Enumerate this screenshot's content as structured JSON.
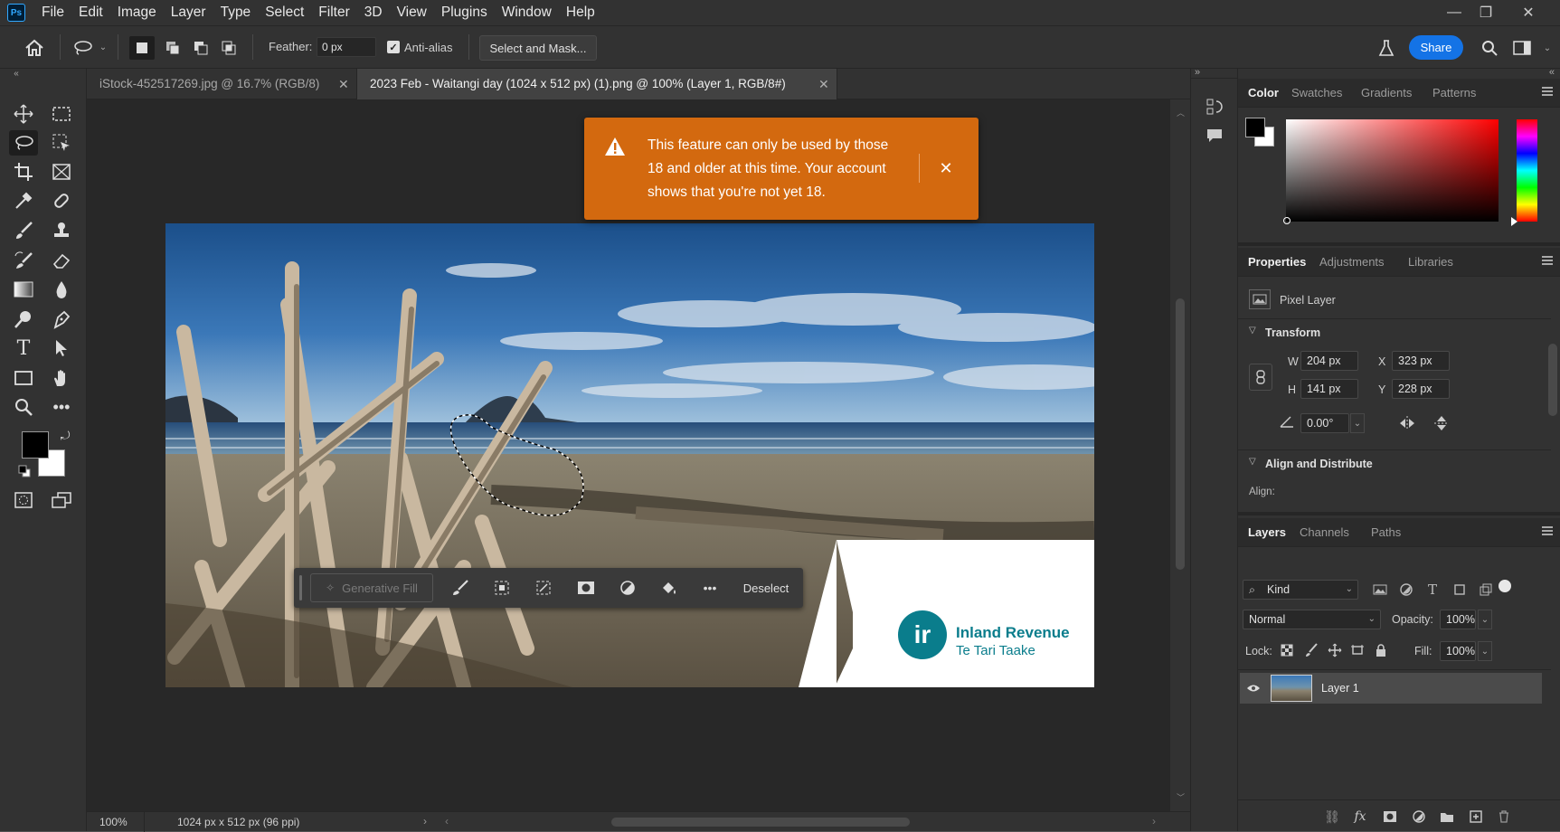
{
  "menubar": {
    "logo": "Ps",
    "items": [
      "File",
      "Edit",
      "Image",
      "Layer",
      "Type",
      "Select",
      "Filter",
      "3D",
      "View",
      "Plugins",
      "Window",
      "Help"
    ]
  },
  "options": {
    "feather_label": "Feather:",
    "feather_value": "0 px",
    "antialias_label": "Anti-alias",
    "antialias_checked": true,
    "select_mask_label": "Select and Mask...",
    "share_label": "Share"
  },
  "tabs": [
    {
      "label": "iStock-452517269.jpg @ 16.7% (RGB/8)",
      "active": false
    },
    {
      "label": "2023 Feb - Waitangi day (1024 x 512 px) (1).png @ 100% (Layer 1, RGB/8#)",
      "active": true
    }
  ],
  "toast": {
    "message": "This feature can only be used by those 18 and older at this time. Your account shows that you're not yet 18.",
    "line1": "This feature can only be used by those",
    "line2": "18 and older at this time. Your account",
    "line3": "shows that you're not yet 18."
  },
  "context_bar": {
    "generative_fill": "Generative Fill",
    "deselect": "Deselect"
  },
  "image": {
    "brand_name": "Inland Revenue",
    "brand_sub": "Te Tari Taake",
    "brand_mark": "ir"
  },
  "status": {
    "zoom": "100%",
    "doc_size": "1024 px x 512 px (96 ppi)"
  },
  "color_panel": {
    "tabs": [
      "Color",
      "Swatches",
      "Gradients",
      "Patterns"
    ],
    "foreground": "#000000",
    "background": "#ffffff"
  },
  "properties_panel": {
    "tabs": [
      "Properties",
      "Adjustments",
      "Libraries"
    ],
    "layer_type": "Pixel Layer",
    "transform_title": "Transform",
    "w_label": "W",
    "w_value": "204 px",
    "h_label": "H",
    "h_value": "141 px",
    "x_label": "X",
    "x_value": "323 px",
    "y_label": "Y",
    "y_value": "228 px",
    "angle_value": "0.00°",
    "align_title": "Align and Distribute",
    "align_label": "Align:"
  },
  "layers_panel": {
    "tabs": [
      "Layers",
      "Channels",
      "Paths"
    ],
    "filter_kind": "Kind",
    "blend_mode": "Normal",
    "opacity_label": "Opacity:",
    "opacity_value": "100%",
    "lock_label": "Lock:",
    "fill_label": "Fill:",
    "fill_value": "100%",
    "layers": [
      {
        "name": "Layer 1",
        "visible": true
      }
    ]
  },
  "colors": {
    "accent": "#1473e6",
    "toast": "#d3690f",
    "brand_teal": "#0a7d8c"
  }
}
